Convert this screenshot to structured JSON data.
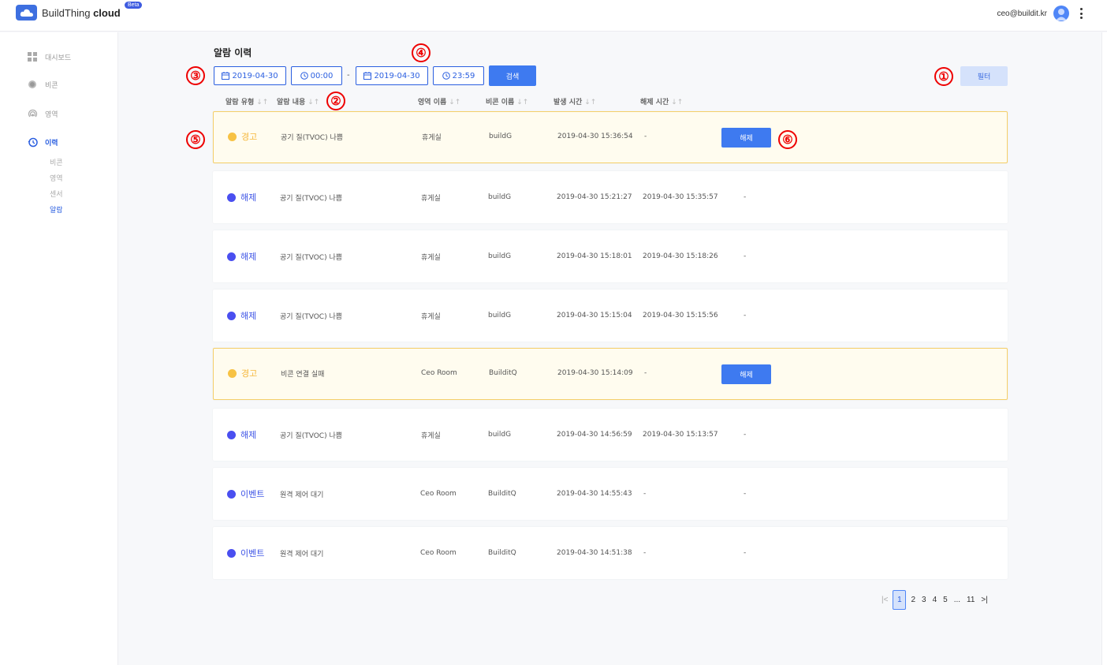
{
  "header": {
    "brand_name": "BuildThing",
    "brand_suffix": "cloud",
    "beta_label": "Beta",
    "user_email": "ceo@buildit.kr"
  },
  "sidebar": {
    "items": [
      {
        "label": "대시보드",
        "icon": "dashboard-grid-icon",
        "active": false
      },
      {
        "label": "비콘",
        "icon": "beacon-dot-icon",
        "active": false
      },
      {
        "label": "영역",
        "icon": "area-signal-icon",
        "active": false
      },
      {
        "label": "이력",
        "icon": "history-clock-icon",
        "active": true
      }
    ],
    "sub_items": [
      {
        "label": "비콘",
        "active": false
      },
      {
        "label": "영역",
        "active": false
      },
      {
        "label": "센서",
        "active": false
      },
      {
        "label": "알람",
        "active": true
      }
    ]
  },
  "main": {
    "title": "알람 이력",
    "search": {
      "start_date": "2019-04-30",
      "start_time": "00:00",
      "separator": "-",
      "end_date": "2019-04-30",
      "end_time": "23:59",
      "search_label": "검색"
    },
    "filter_label": "필터",
    "columns": [
      "알람 유형",
      "알람 내용",
      "영역 이름",
      "비콘 이름",
      "발생 시간",
      "해제 시간"
    ],
    "sort_icon": "↓↑",
    "release_label": "해제",
    "rows": [
      {
        "type": "경고",
        "kind": "warn",
        "content": "공기 질(TVOC) 나쁨",
        "area": "휴게실",
        "beacon": "buildG",
        "occurred": "2019-04-30 15:36:54",
        "released": "-",
        "extra": ""
      },
      {
        "type": "해제",
        "kind": "info",
        "content": "공기 질(TVOC) 나쁨",
        "area": "휴게실",
        "beacon": "buildG",
        "occurred": "2019-04-30 15:21:27",
        "released": "2019-04-30 15:35:57",
        "extra": "-"
      },
      {
        "type": "해제",
        "kind": "info",
        "content": "공기 질(TVOC) 나쁨",
        "area": "휴게실",
        "beacon": "buildG",
        "occurred": "2019-04-30 15:18:01",
        "released": "2019-04-30 15:18:26",
        "extra": "-"
      },
      {
        "type": "해제",
        "kind": "info",
        "content": "공기 질(TVOC) 나쁨",
        "area": "휴게실",
        "beacon": "buildG",
        "occurred": "2019-04-30 15:15:04",
        "released": "2019-04-30 15:15:56",
        "extra": "-"
      },
      {
        "type": "경고",
        "kind": "warn",
        "content": "비콘 연결 실패",
        "area": "Ceo Room",
        "beacon": "BuilditQ",
        "occurred": "2019-04-30 15:14:09",
        "released": "-",
        "extra": ""
      },
      {
        "type": "해제",
        "kind": "info",
        "content": "공기 질(TVOC) 나쁨",
        "area": "휴게실",
        "beacon": "buildG",
        "occurred": "2019-04-30 14:56:59",
        "released": "2019-04-30 15:13:57",
        "extra": "-"
      },
      {
        "type": "이벤트",
        "kind": "info",
        "content": "원격 제어 대기",
        "area": "Ceo Room",
        "beacon": "BuilditQ",
        "occurred": "2019-04-30 14:55:43",
        "released": "-",
        "extra": "-"
      },
      {
        "type": "이벤트",
        "kind": "info",
        "content": "원격 제어 대기",
        "area": "Ceo Room",
        "beacon": "BuilditQ",
        "occurred": "2019-04-30 14:51:38",
        "released": "-",
        "extra": "-"
      }
    ],
    "pagination": {
      "first": "|<",
      "pages": [
        "1",
        "2",
        "3",
        "4",
        "5",
        "...",
        "11"
      ],
      "current": "1",
      "last": ">|"
    }
  },
  "markers": [
    "①",
    "②",
    "③",
    "④",
    "⑤",
    "⑥"
  ],
  "colors": {
    "accent": "#3e7af0",
    "warn_dot": "#f7c244",
    "warn_text": "#f5b73b",
    "info_dot": "#4a4ff0",
    "info_text": "#3e54e6",
    "marker": "#e00000"
  }
}
